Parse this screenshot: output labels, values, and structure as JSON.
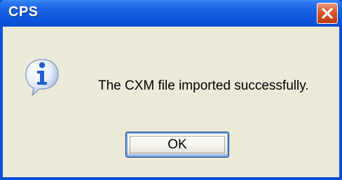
{
  "dialog": {
    "title": "CPS",
    "message": "The CXM file imported successfully.",
    "ok_label": "OK"
  },
  "icons": {
    "close": "close-icon",
    "info": "info-icon"
  },
  "colors": {
    "titlebar": "#0a4fd8",
    "close_button": "#d7552c",
    "client_background": "#ece9d8",
    "info_icon": "#1f5fd0"
  }
}
